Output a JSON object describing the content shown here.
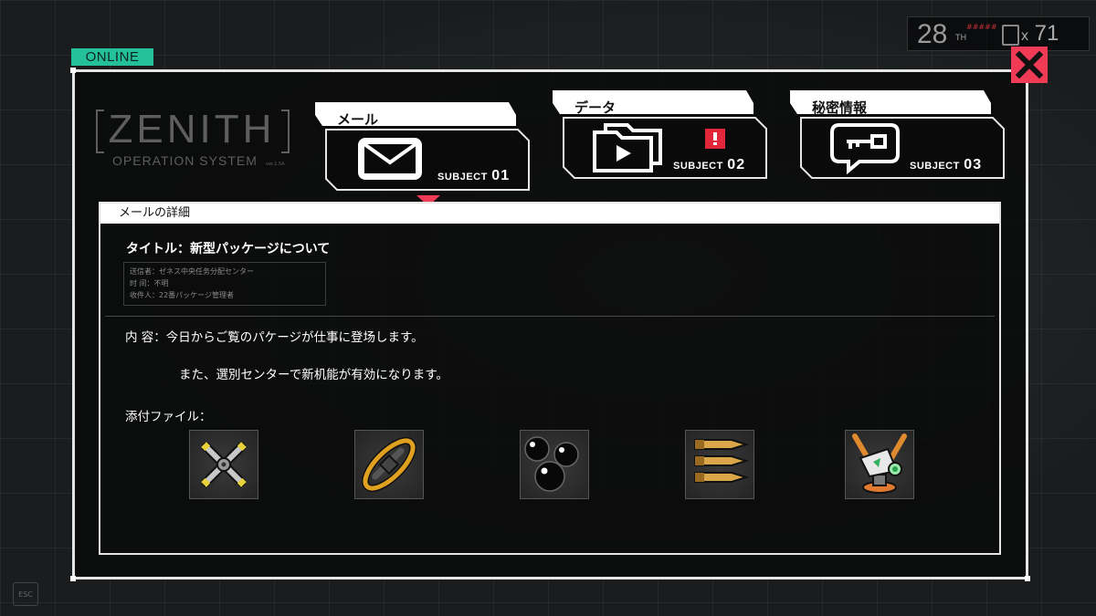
{
  "status": {
    "online_label": "ONLINE"
  },
  "hud": {
    "day": "28",
    "day_suffix": "TH",
    "day_tag": "#####",
    "ticket_count": "71",
    "ticket_prefix": "x",
    "escape_label": "ESC"
  },
  "logo": {
    "main": "ZENITH",
    "sub": "OPERATION SYSTEM",
    "version": "ver.1.5A"
  },
  "tabs": [
    {
      "label": "メール",
      "subject_prefix": "SUBJECT",
      "subject_number": "01",
      "icon": "envelope-icon",
      "active": true,
      "alert": false
    },
    {
      "label": "データ",
      "subject_prefix": "SUBJECT",
      "subject_number": "02",
      "icon": "video-folder-icon",
      "active": false,
      "alert": true
    },
    {
      "label": "秘密情報",
      "subject_prefix": "SUBJECT",
      "subject_number": "03",
      "icon": "key-chat-icon",
      "active": false,
      "alert": false
    }
  ],
  "detail": {
    "header": "メールの詳細",
    "title": "タイトル：新型パッケージについて",
    "meta": [
      "送信者：ゼネス中央任务分配センター",
      "时 间：不明",
      "收件人：22番パッケージ管理者"
    ],
    "content_line1": "内 容：今日からご覧のパケージが仕事に登场します。",
    "content_line2": "また、選別センターで新机能が有効になります。",
    "attachments_label": "添付ファイル：",
    "attachments": [
      {
        "icon": "propeller-icon"
      },
      {
        "icon": "ring-blade-icon"
      },
      {
        "icon": "black-orbs-icon"
      },
      {
        "icon": "bullets-icon"
      },
      {
        "icon": "turret-robot-icon"
      }
    ]
  },
  "colors": {
    "accent": "#24c09a",
    "close": "#ef3b55",
    "alert": "#e3273a",
    "panel_border": "#e5e5e5"
  }
}
